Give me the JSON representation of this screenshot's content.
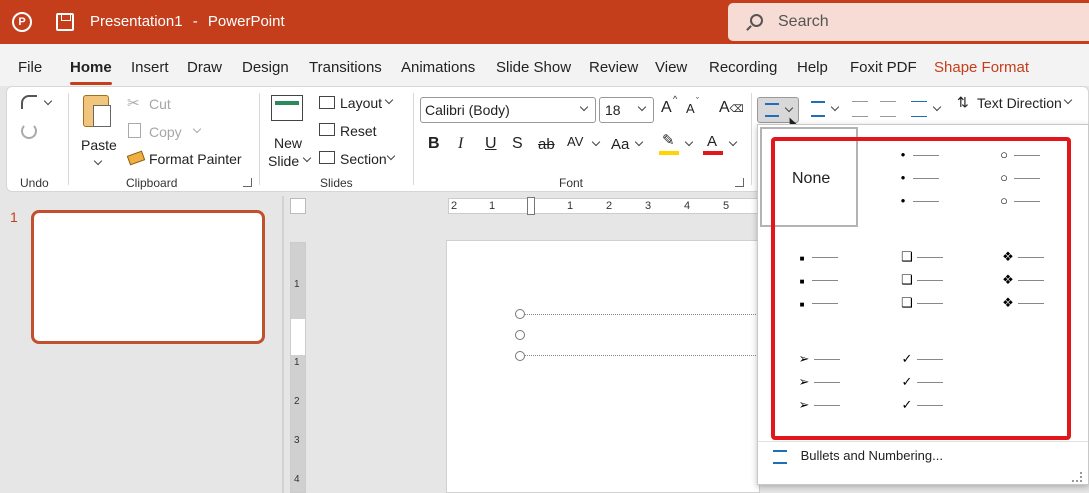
{
  "titlebar": {
    "doc_title": "Presentation1",
    "separator": "-",
    "app_name": "PowerPoint",
    "search_label": "Search"
  },
  "menu": {
    "tabs": [
      {
        "label": "File"
      },
      {
        "label": "Home"
      },
      {
        "label": "Insert"
      },
      {
        "label": "Draw"
      },
      {
        "label": "Design"
      },
      {
        "label": "Transitions"
      },
      {
        "label": "Animations"
      },
      {
        "label": "Slide Show"
      },
      {
        "label": "Review"
      },
      {
        "label": "View"
      },
      {
        "label": "Recording"
      },
      {
        "label": "Help"
      },
      {
        "label": "Foxit PDF"
      },
      {
        "label": "Shape Format"
      }
    ],
    "active_tab": "Home"
  },
  "ribbon": {
    "undo": {
      "group_label": "Undo"
    },
    "clipboard": {
      "paste_label": "Paste",
      "cut_label": "Cut",
      "copy_label": "Copy",
      "format_painter_label": "Format Painter",
      "group_label": "Clipboard"
    },
    "slides": {
      "new_slide_line1": "New",
      "new_slide_line2": "Slide",
      "layout_label": "Layout",
      "reset_label": "Reset",
      "section_label": "Section",
      "group_label": "Slides"
    },
    "font": {
      "font_name": "Calibri (Body)",
      "font_size": "18",
      "grow_label": "A",
      "shrink_label": "A",
      "bold": "B",
      "italic": "I",
      "underline": "U",
      "shadow": "S",
      "strike": "ab",
      "spacing": "AV",
      "change_case": "Aa",
      "font_color_letter": "A",
      "highlight_color": "#ffd400",
      "font_color": "#e3161c",
      "group_label": "Font"
    },
    "paragraph": {
      "text_direction_label": "Text Direction"
    }
  },
  "thumbnails": {
    "slide_number": "1"
  },
  "ruler": {
    "h_labels": [
      "2",
      "1",
      "1",
      "2",
      "3",
      "4",
      "5"
    ],
    "v_labels": [
      "1",
      "1",
      "2",
      "3",
      "4"
    ]
  },
  "bullet_menu": {
    "none_label": "None",
    "styles": [
      {
        "glyph": "•",
        "name": "filled-round"
      },
      {
        "glyph": "○",
        "name": "hollow-round"
      },
      {
        "glyph": "■",
        "name": "filled-square"
      },
      {
        "glyph": "❑",
        "name": "hollow-square"
      },
      {
        "glyph": "❖",
        "name": "star"
      },
      {
        "glyph": "➢",
        "name": "arrow"
      },
      {
        "glyph": "✓",
        "name": "checkmark"
      }
    ],
    "footer_label": "Bullets and Numbering..."
  },
  "colors": {
    "accent": "#c43e1c",
    "highlight_frame": "#e3161c"
  }
}
